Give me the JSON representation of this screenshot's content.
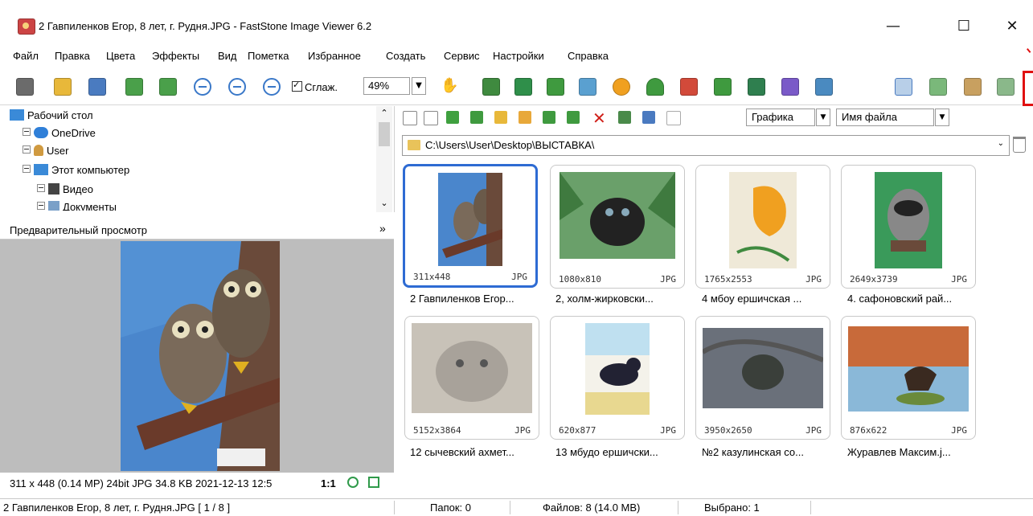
{
  "window": {
    "title": "2 Гавпиленков Егор, 8 лет, г. Рудня.JPG  -  FastStone Image Viewer 6.2",
    "controls": [
      "—",
      "☐",
      "✕"
    ]
  },
  "menu": [
    "Файл",
    "Правка",
    "Цвета",
    "Эффекты",
    "Вид",
    "Пометка",
    "Избранное",
    "Создать",
    "Сервис",
    "Настройки",
    "Справка"
  ],
  "toolbar": {
    "smooth_label": "Сглаж.",
    "zoom_value": "49%"
  },
  "tree": {
    "items": [
      {
        "label": "Рабочий стол"
      },
      {
        "label": "OneDrive"
      },
      {
        "label": "User"
      },
      {
        "label": "Этот компьютер"
      },
      {
        "label": "Видео"
      },
      {
        "label": "Документы"
      }
    ]
  },
  "preview": {
    "header": "Предварительный просмотр",
    "chevron": "»",
    "info": "311 x 448 (0.14 MP)  24bit  JPG  34.8 KB  2021-12-13 12:5",
    "one_to_one": "1:1"
  },
  "browser": {
    "filter": "Графика",
    "sort": "Имя файла",
    "path": "C:\\Users\\User\\Desktop\\ВЫСТАВКА\\",
    "thumbnails": [
      {
        "dims": "311x448",
        "format": "JPG",
        "label": "2 Гавпиленков Егор...",
        "selected": true
      },
      {
        "dims": "1080x810",
        "format": "JPG",
        "label": "2, холм-жирковски..."
      },
      {
        "dims": "1765x2553",
        "format": "JPG",
        "label": "4 мбоу ершичская ..."
      },
      {
        "dims": "2649x3739",
        "format": "JPG",
        "label": "4. сафоновский рай..."
      },
      {
        "dims": "5152x3864",
        "format": "JPG",
        "label": "12 сычевский ахмет..."
      },
      {
        "dims": "620x877",
        "format": "JPG",
        "label": "13 мбудо ершичски..."
      },
      {
        "dims": "3950x2650",
        "format": "JPG",
        "label": "№2 казулинская со..."
      },
      {
        "dims": "876x622",
        "format": "JPG",
        "label": "Журавлев Максим.j..."
      }
    ]
  },
  "status": {
    "file": "2 Гавпиленков Егор, 8 лет, г. Рудня.JPG [ 1 / 8 ]",
    "folders": "Папок: 0",
    "files": "Файлов: 8 (14.0 MB)",
    "selected": "Выбрано: 1"
  },
  "colors": {
    "selection_border": "#2e6bd3",
    "highlight_marker": "#e01010"
  }
}
